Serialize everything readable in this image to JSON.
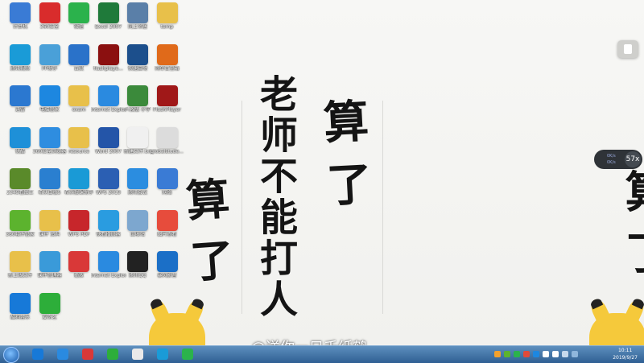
{
  "wallpaper": {
    "main_text": "老师不能打人",
    "side_text": "算了",
    "side_text_left": "算了",
    "edge_text": "算了"
  },
  "watermark": "@送你一只千纸鹤",
  "widgets": {
    "speed_value": "57x",
    "speed_up": "0K/s",
    "speed_down": "0K/s"
  },
  "desktop_icons": [
    {
      "label": "计算机",
      "color": "#3a7bd5",
      "icon": "computer-icon"
    },
    {
      "label": "360安全",
      "color": "#d92c2c",
      "icon": "shield-icon"
    },
    {
      "label": "微信",
      "color": "#2bb24c",
      "icon": "wechat-icon"
    },
    {
      "label": "Excel 2007",
      "color": "#1f7a3a",
      "icon": "excel-icon"
    },
    {
      "label": "网上邻居",
      "color": "#5a7fa8",
      "icon": "network-icon"
    },
    {
      "label": "temp",
      "color": "#e8c04a",
      "icon": "folder-icon"
    },
    {
      "label": "腾讯视频",
      "color": "#1a9bd7",
      "icon": "video-icon"
    },
    {
      "label": "PP助手",
      "color": "#4aa0d8",
      "icon": "assistant-icon"
    },
    {
      "label": "百灵",
      "color": "#2a72c9",
      "icon": "bird-icon"
    },
    {
      "label": "flashplaye...",
      "color": "#8b1010",
      "icon": "flash-icon"
    },
    {
      "label": "快速启动",
      "color": "#1c4f8c",
      "icon": "launch-icon"
    },
    {
      "label": "简单百宝箱",
      "color": "#e06a1a",
      "icon": "toolbox-icon"
    },
    {
      "label": "迅雷",
      "color": "#2b78d0",
      "icon": "thunder-icon"
    },
    {
      "label": "电脑管家",
      "color": "#1d87e0",
      "icon": "pc-manager-icon"
    },
    {
      "label": "exam",
      "color": "#e8c04a",
      "icon": "folder-icon"
    },
    {
      "label": "Internet Explorer",
      "color": "#2a8ae0",
      "icon": "ie-icon"
    },
    {
      "label": "人教版 小学",
      "color": "#3b8a3b",
      "icon": "books-icon"
    },
    {
      "label": "FlashPlayer",
      "color": "#a01818",
      "icon": "flash-icon"
    },
    {
      "label": "优酷",
      "color": "#1e90d8",
      "icon": "youku-icon"
    },
    {
      "label": "360安全浏览器",
      "color": "#2e8de0",
      "icon": "browser-icon"
    },
    {
      "label": "resource",
      "color": "#e8c04a",
      "icon": "folder-icon"
    },
    {
      "label": "Word 2007",
      "color": "#2455a8",
      "icon": "word-icon"
    },
    {
      "label": "新建文件.txt",
      "color": "#f0f0f0",
      "icon": "text-file-icon"
    },
    {
      "label": "globalstude...",
      "color": "#dcdcdc",
      "icon": "file-icon"
    },
    {
      "label": "2345看图王",
      "color": "#5a8a2a",
      "icon": "image-viewer-icon"
    },
    {
      "label": "希沃白板5",
      "color": "#2a7fd0",
      "icon": "whiteboard-icon"
    },
    {
      "label": "希沃授课助手",
      "color": "#1a9ad6",
      "icon": "teaching-icon"
    },
    {
      "label": "WPS 2019",
      "color": "#2b5fb3",
      "icon": "wps-icon"
    },
    {
      "label": "腾讯会议",
      "color": "#2b8de0",
      "icon": "meeting-icon"
    },
    {
      "label": "网络",
      "color": "#3a7bd5",
      "icon": "globe-icon"
    },
    {
      "label": "360软件管家",
      "color": "#5cb32e",
      "icon": "software-icon"
    },
    {
      "label": "课件 资料",
      "color": "#e8c04a",
      "icon": "folder-icon"
    },
    {
      "label": "WPS PDF",
      "color": "#c7262b",
      "icon": "pdf-icon"
    },
    {
      "label": "快看播放器",
      "color": "#2a9ce0",
      "icon": "player-icon"
    },
    {
      "label": "回收站",
      "color": "#7da7cf",
      "icon": "recycle-bin-icon"
    },
    {
      "label": "图片查看",
      "color": "#e74c3c",
      "icon": "photo-icon"
    },
    {
      "label": "新上线文件",
      "color": "#e8c04a",
      "icon": "folder-icon"
    },
    {
      "label": "课件管理器",
      "color": "#3a9ad9",
      "icon": "courseware-icon"
    },
    {
      "label": "播放",
      "color": "#d93838",
      "icon": "play-icon"
    },
    {
      "label": "Internet Explorer",
      "color": "#2a8ae0",
      "icon": "ie-icon"
    },
    {
      "label": "腾讯QQ",
      "color": "#222222",
      "icon": "qq-icon"
    },
    {
      "label": "暴风影音",
      "color": "#1b6fc7",
      "icon": "media-icon"
    },
    {
      "label": "酷狗音乐",
      "color": "#1779d8",
      "icon": "kugou-icon"
    },
    {
      "label": "爱奇艺",
      "color": "#2dae3a",
      "icon": "iqiyi-icon"
    }
  ],
  "taskbar": {
    "apps": [
      {
        "icon": "kugou-icon",
        "color": "#1779d8"
      },
      {
        "icon": "ie-icon",
        "color": "#2a8ae0"
      },
      {
        "icon": "player-icon",
        "color": "#d93838"
      },
      {
        "icon": "iqiyi-icon",
        "color": "#2dae3a"
      },
      {
        "icon": "file-icon",
        "color": "#e9e9e9"
      },
      {
        "icon": "video-icon",
        "color": "#1a9bd7"
      },
      {
        "icon": "wechat-icon",
        "color": "#2bb24c"
      }
    ],
    "clock_time": "10:11",
    "clock_date": "2019/9/27"
  }
}
